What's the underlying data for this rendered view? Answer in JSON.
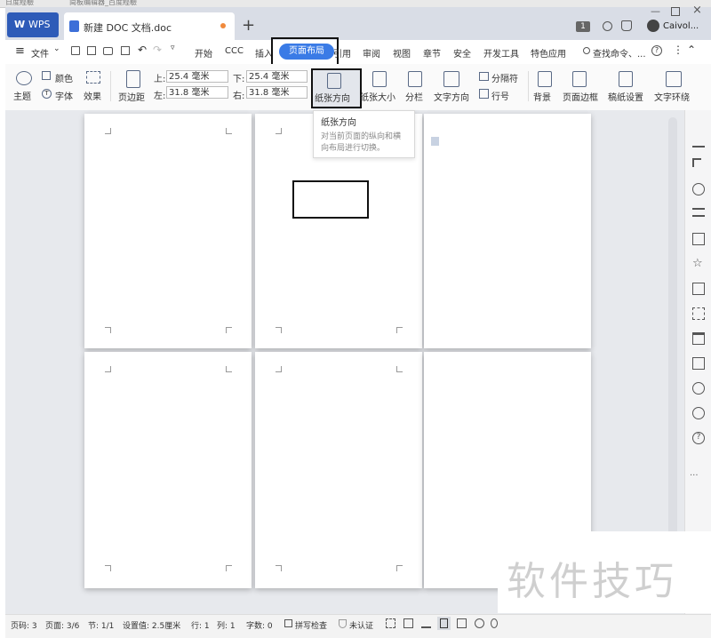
{
  "bg_tabs": [
    "日度經驗",
    "简板编辑器_百度經驗"
  ],
  "titlebar": {
    "app_label": "WPS",
    "doc_title": "新建 DOC 文档.doc",
    "badge": "1",
    "user": "Caivol...",
    "new_tab": "+"
  },
  "menu": {
    "file": "文件",
    "items": [
      "开始",
      "CCC",
      "插入",
      "页面布局",
      "引用",
      "审阅",
      "视图",
      "章节",
      "安全",
      "开发工具",
      "特色应用"
    ],
    "search": "查找命令、..."
  },
  "ribbon": {
    "theme": "主题",
    "color": "颜色",
    "font": "字体",
    "effect": "效果",
    "margin": "页边距",
    "top_label": "上:",
    "top_value": "25.4 毫米",
    "left_label": "左:",
    "left_value": "31.8 毫米",
    "bottom_label": "下:",
    "bottom_value": "25.4 毫米",
    "right_label": "右:",
    "right_value": "31.8 毫米",
    "orientation": "纸张方向",
    "paper_size": "纸张大小",
    "columns": "分栏",
    "text_direction": "文字方向",
    "separator": "分隔符",
    "line_number": "行号",
    "background": "背景",
    "page_border": "页面边框",
    "grid_paper": "稿纸设置",
    "text_wrap": "文字环绕"
  },
  "tooltip": {
    "title": "纸张方向",
    "body_line1": "对当前页面的纵向和横",
    "body_line2": "向布局进行切换。"
  },
  "status": {
    "page_code": "页码: 3",
    "pages": "页面: 3/6",
    "section": "节: 1/1",
    "setting": "设置值: 2.5厘米",
    "row": "行: 1",
    "col": "列: 1",
    "words": "字数: 0",
    "spellcheck": "拼写检查",
    "certify": "未认证"
  },
  "watermark": "软件技巧",
  "colors": {
    "accent": "#3a7be6",
    "wps_tab": "#2e5bb8",
    "workspace": "#e7e9ed"
  }
}
